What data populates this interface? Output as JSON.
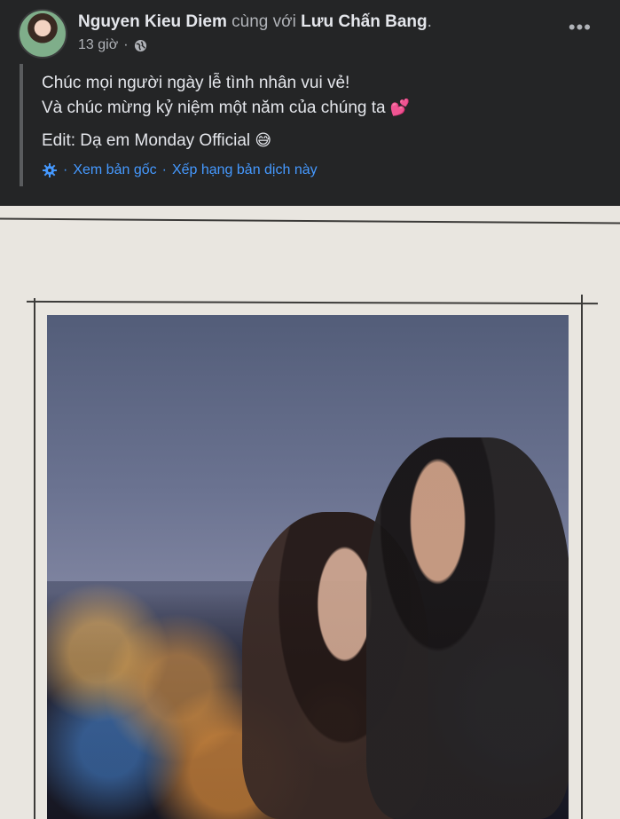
{
  "post": {
    "author": "Nguyen Kieu Diem",
    "with_text": "cùng với",
    "tagged_person": "Lưu Chấn Bang",
    "tagged_suffix": ".",
    "timestamp": "13 giờ",
    "dot": "·",
    "more_label": "•••",
    "lines": [
      "Chúc mọi người ngày lễ tình nhân vui vẻ!",
      "Và chúc mừng kỷ niệm một năm của chúng ta",
      "Edit: Dạ em Monday Official"
    ],
    "emojis": {
      "hearts": "💕",
      "sweat_smile": "😅"
    },
    "translation": {
      "see_original": "Xem bản gốc",
      "rate_translation": "Xếp hạng bản dịch này",
      "separator": "·"
    }
  },
  "colors": {
    "background": "#242526",
    "primary_text": "#e4e6eb",
    "secondary_text": "#b0b3b8",
    "link": "#4599ff",
    "paper": "#e9e6e0"
  },
  "icons": {
    "privacy": "globe-icon",
    "translate": "gear-icon",
    "menu": "more-options-icon"
  }
}
